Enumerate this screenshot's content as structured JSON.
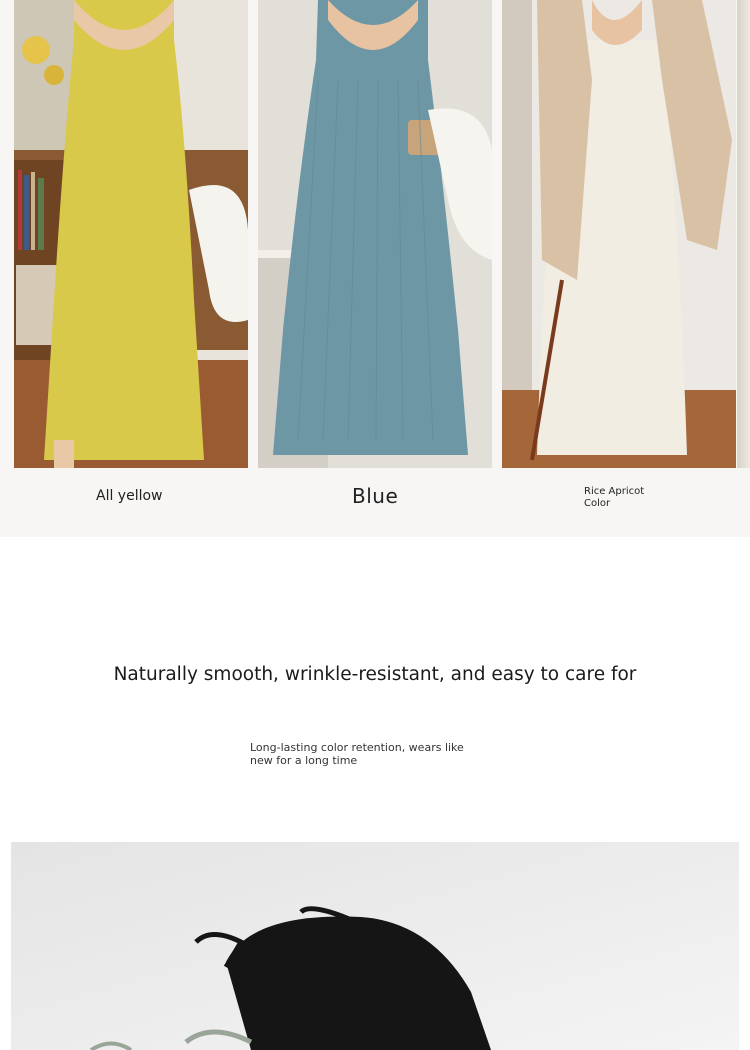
{
  "colors": {
    "yellow_dress": "#d9c94a",
    "blue_dress": "#6e97a6",
    "apricot_dress": "#f1ede2",
    "cardigan": "#d9c1a5",
    "black_garment": "#151515"
  },
  "swatches": [
    {
      "label": "All yellow"
    },
    {
      "label": "Blue"
    },
    {
      "label": "Rice Apricot Color"
    }
  ],
  "feature": {
    "headline": "Naturally smooth, wrinkle-resistant, and easy to care for",
    "subline": "Long-lasting color retention, wears like new for a long time"
  }
}
